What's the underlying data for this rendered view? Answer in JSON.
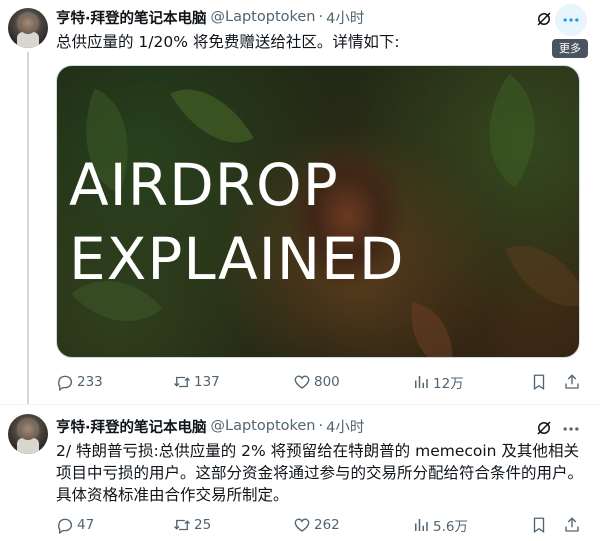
{
  "tweets": [
    {
      "author_name": "亨特·拜登的笔记本电脑",
      "handle": "@Laptoptoken",
      "separator": "·",
      "time": "4小时",
      "text": "总供应量的 1/20% 将免费赠送给社区。详情如下:",
      "media": {
        "title_line1": "AIRDROP",
        "title_line2": "EXPLAINED"
      },
      "more_tooltip": "更多",
      "stats": {
        "replies": "233",
        "retweets": "137",
        "likes": "800",
        "views": "12万"
      }
    },
    {
      "author_name": "亨特·拜登的笔记本电脑",
      "handle": "@Laptoptoken",
      "separator": "·",
      "time": "4小时",
      "text": "2/ 特朗普亏损:总供应量的 2% 将预留给在特朗普的 memecoin 及其他相关项目中亏损的用户。这部分资金将通过参与的交易所分配给符合条件的用户。具体资格标准由合作交易所制定。",
      "stats": {
        "replies": "47",
        "retweets": "25",
        "likes": "262",
        "views": "5.6万"
      }
    }
  ],
  "colors": {
    "text": "#0f1419",
    "muted": "#536471",
    "thread_line": "#cfd9de",
    "hover_bg": "#e8f5fd",
    "tooltip_bg": "#4a5460"
  },
  "icons": [
    "grok-icon",
    "more-icon",
    "reply-icon",
    "retweet-icon",
    "like-icon",
    "views-icon",
    "bookmark-icon",
    "share-icon"
  ]
}
